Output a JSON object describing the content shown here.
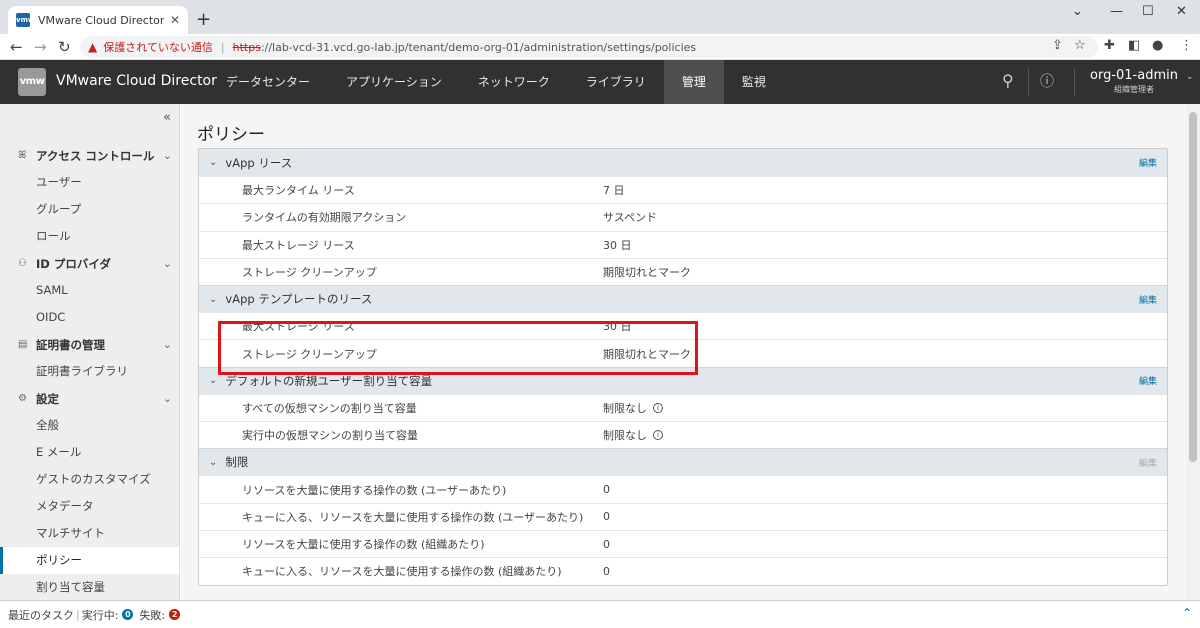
{
  "browser": {
    "tab_title": "VMware Cloud Director - ポリシー",
    "favicon_text": "vmw",
    "security_warning": "保護されていない通信",
    "url_scheme": "https",
    "url_rest": "://lab-vcd-31.vcd.go-lab.jp/tenant/demo-org-01/administration/settings/policies"
  },
  "header": {
    "logo_text": "vmw",
    "product_name": "VMware Cloud Director",
    "nav": [
      "データセンター",
      "アプリケーション",
      "ネットワーク",
      "ライブラリ",
      "管理",
      "監視"
    ],
    "active_nav": "管理",
    "user_name": "org-01-admin",
    "user_role": "組織管理者"
  },
  "sidebar": {
    "groups": [
      {
        "label": "アクセス コントロール",
        "icon": "users-icon",
        "items": [
          "ユーザー",
          "グループ",
          "ロール"
        ]
      },
      {
        "label": "ID プロバイダ",
        "icon": "id-provider-icon",
        "items": [
          "SAML",
          "OIDC"
        ]
      },
      {
        "label": "証明書の管理",
        "icon": "certificate-icon",
        "items": [
          "証明書ライブラリ"
        ]
      },
      {
        "label": "設定",
        "icon": "gear-icon",
        "items": [
          "全般",
          "E メール",
          "ゲストのカスタマイズ",
          "メタデータ",
          "マルチサイト",
          "ポリシー",
          "割り当て容量"
        ]
      }
    ],
    "active_item": "ポリシー"
  },
  "main": {
    "page_title": "ポリシー",
    "edit_label": "編集",
    "sections": [
      {
        "title": "vApp リース",
        "edit_enabled": true,
        "rows": [
          {
            "label": "最大ランタイム リース",
            "value": "7 日"
          },
          {
            "label": "ランタイムの有効期限アクション",
            "value": "サスペンド"
          },
          {
            "label": "最大ストレージ リース",
            "value": "30 日"
          },
          {
            "label": "ストレージ クリーンアップ",
            "value": "期限切れとマーク"
          }
        ]
      },
      {
        "title": "vApp テンプレートのリース",
        "edit_enabled": true,
        "rows": [
          {
            "label": "最大ストレージ リース",
            "value": "30 日"
          },
          {
            "label": "ストレージ クリーンアップ",
            "value": "期限切れとマーク"
          }
        ]
      },
      {
        "title": "デフォルトの新規ユーザー割り当て容量",
        "edit_enabled": true,
        "rows": [
          {
            "label": "すべての仮想マシンの割り当て容量",
            "value": "制限なし",
            "info": true
          },
          {
            "label": "実行中の仮想マシンの割り当て容量",
            "value": "制限なし",
            "info": true
          }
        ]
      },
      {
        "title": "制限",
        "edit_enabled": false,
        "rows": [
          {
            "label": "リソースを大量に使用する操作の数 (ユーザーあたり)",
            "value": "0"
          },
          {
            "label": "キューに入る、リソースを大量に使用する操作の数 (ユーザーあたり)",
            "value": "0"
          },
          {
            "label": "リソースを大量に使用する操作の数 (組織あたり)",
            "value": "0"
          },
          {
            "label": "キューに入る、リソースを大量に使用する操作の数 (組織あたり)",
            "value": "0"
          }
        ]
      }
    ]
  },
  "footer": {
    "recent_tasks": "最近のタスク",
    "running_label": "実行中:",
    "running_count": "0",
    "failed_label": "失敗:",
    "failed_count": "2"
  },
  "colors": {
    "header_bg": "#313131",
    "accent": "#0072a3",
    "highlight": "#e0131c",
    "failed": "#c21d00"
  }
}
